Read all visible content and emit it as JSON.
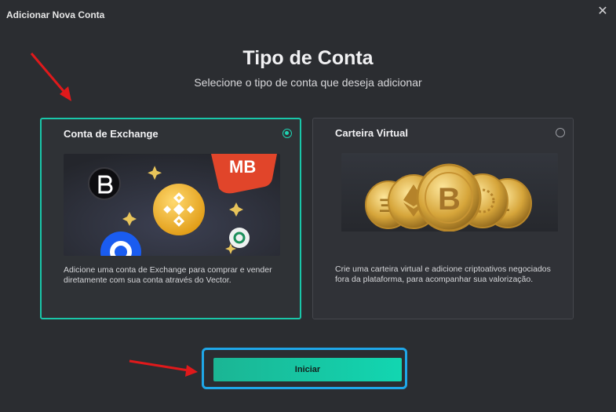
{
  "window": {
    "title": "Adicionar Nova Conta",
    "close_icon": "close-icon"
  },
  "header": {
    "title": "Tipo de Conta",
    "subtitle": "Selecione o tipo de conta que deseja adicionar"
  },
  "cards": [
    {
      "id": "exchange",
      "title": "Conta de Exchange",
      "selected": true,
      "description": "Adicione uma conta de Exchange para comprar e vender diretamente com sua conta através do Vector.",
      "art": {
        "badge_text": "MB"
      }
    },
    {
      "id": "wallet",
      "title": "Carteira Virtual",
      "selected": false,
      "description": "Crie uma carteira virtual e adicione criptoativos negociados fora da plataforma, para acompanhar sua valorização."
    }
  ],
  "actions": {
    "start_label": "Iniciar"
  },
  "colors": {
    "accent": "#19c7a9",
    "highlight_frame": "#1fa7e8",
    "annotation_arrow": "#e0191b"
  }
}
